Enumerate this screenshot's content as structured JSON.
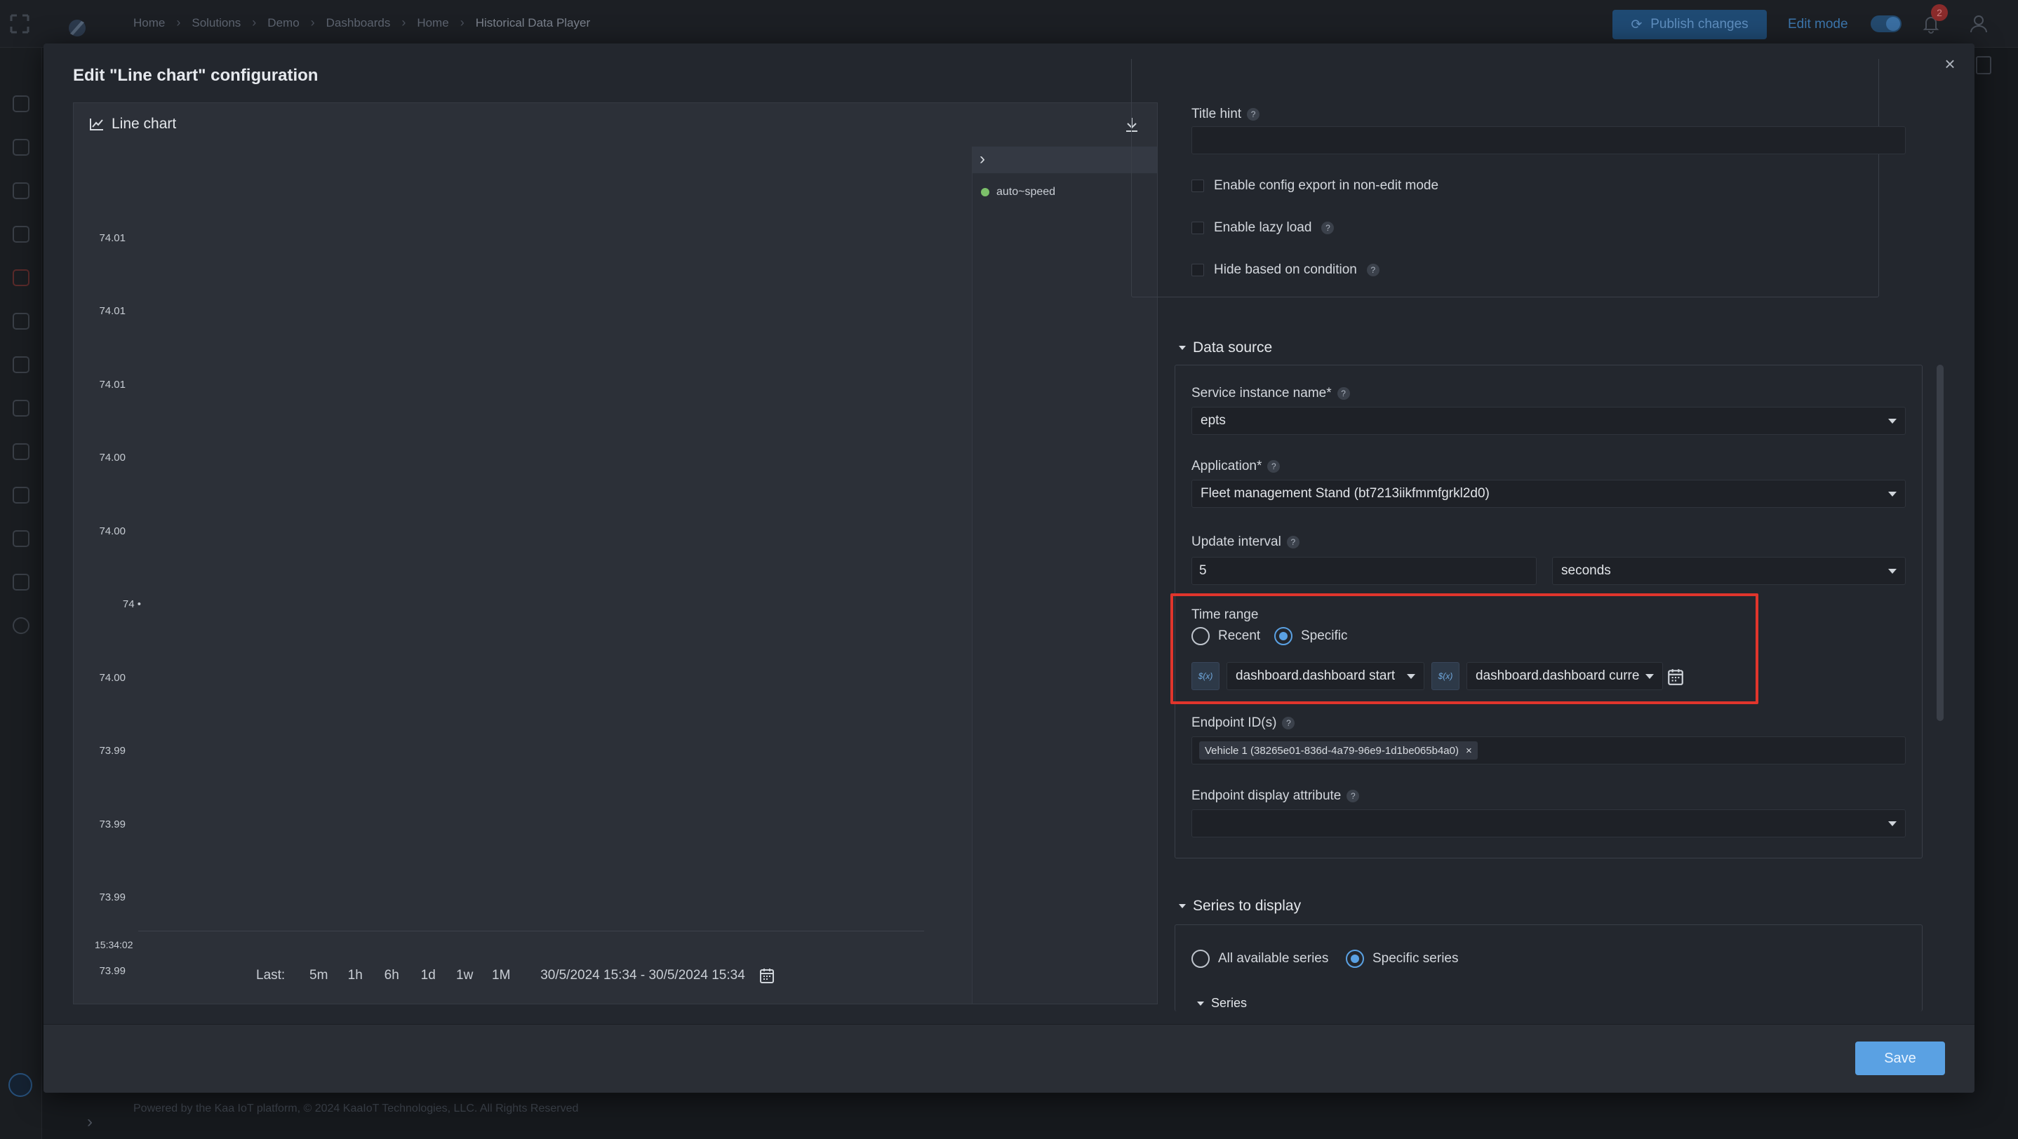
{
  "app": {
    "breadcrumb": [
      "Home",
      "Solutions",
      "Demo",
      "Dashboards",
      "Home",
      "Historical Data Player"
    ],
    "publish_label": "Publish changes",
    "edit_mode_label": "Edit mode",
    "notification_count": "2",
    "footer": "Powered by the Kaa IoT platform, © 2024 KaaIoT Technologies, LLC. All Rights Reserved"
  },
  "modal": {
    "title": "Edit \"Line chart\" configuration",
    "close_glyph": "×",
    "save_label": "Save"
  },
  "preview": {
    "widget_title": "Line chart",
    "y_ticks": [
      "74.01",
      "74.01",
      "74.01",
      "74.00",
      "74.00",
      "74 •",
      "74.00",
      "73.99",
      "73.99",
      "73.99",
      "73.99"
    ],
    "x_tick": "15:34:02",
    "legend_toggle": "›",
    "legend": [
      {
        "name": "auto~speed",
        "color": "#7cc06a"
      }
    ],
    "range": {
      "last_label": "Last:",
      "buttons": [
        "5m",
        "1h",
        "6h",
        "1d",
        "1w",
        "1M"
      ],
      "dates": "30/5/2024 15:34 - 30/5/2024 15:34"
    }
  },
  "settings": {
    "title_hint_label": "Title hint",
    "title_hint_value": "",
    "checkboxes": [
      {
        "label": "Enable config export in non-edit mode",
        "checked": false
      },
      {
        "label": "Enable lazy load",
        "checked": false,
        "help": true
      },
      {
        "label": "Hide based on condition",
        "checked": false,
        "help": true
      }
    ],
    "data_source": {
      "heading": "Data source",
      "service_label": "Service instance name*",
      "service_value": "epts",
      "application_label": "Application*",
      "application_value": "Fleet management Stand (bt7213iikfmmfgrkl2d0)",
      "update_label": "Update interval",
      "update_value": "5",
      "update_unit": "seconds",
      "time_range_label": "Time range",
      "radio_recent": "Recent",
      "radio_specific": "Specific",
      "selected_range_mode": "Specific",
      "fx_label": "$(x)",
      "from_value": "dashboard.dashboard start",
      "to_value": "dashboard.dashboard curre",
      "endpoint_label": "Endpoint ID(s)",
      "endpoint_tag": "Vehicle 1 (38265e01-836d-4a79-96e9-1d1be065b4a0)",
      "endpoint_tag_remove": "×",
      "display_attr_label": "Endpoint display attribute",
      "display_attr_value": ""
    },
    "series": {
      "heading": "Series to display",
      "radio_all": "All available series",
      "radio_specific": "Specific series",
      "selected": "Specific series",
      "sub_heading": "Series"
    }
  },
  "colors": {
    "accent": "#5aa1e3",
    "highlight": "#e0352c",
    "legend_dot": "#7cc06a"
  }
}
